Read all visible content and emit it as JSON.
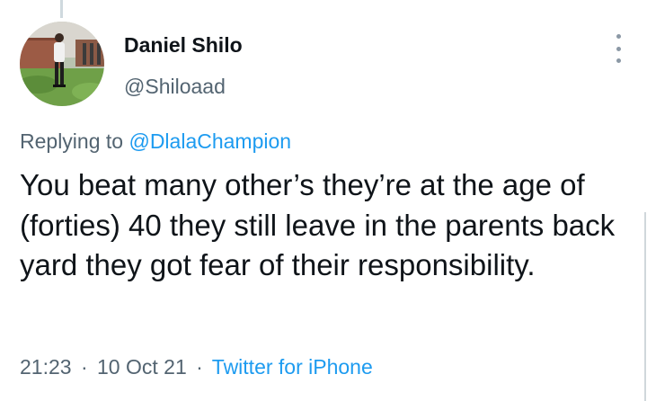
{
  "author": {
    "display_name": "Daniel Shilo",
    "handle": "@Shiloaad",
    "avatar_icon": "profile-photo"
  },
  "more_icon": "more-vertical-icon",
  "reply_context": {
    "prefix": "Replying to",
    "mention": "@DlalaChampion"
  },
  "tweet": {
    "text": "You beat many other’s they’re at the age of (forties) 40 they still leave in the parents back yard they got fear of their responsibility."
  },
  "meta": {
    "time": "21:23",
    "date": "10 Oct 21",
    "separator": "·",
    "source": "Twitter for iPhone"
  },
  "colors": {
    "accent": "#1d9bf0",
    "secondary_text": "#536471",
    "primary_text": "#0f1419"
  }
}
